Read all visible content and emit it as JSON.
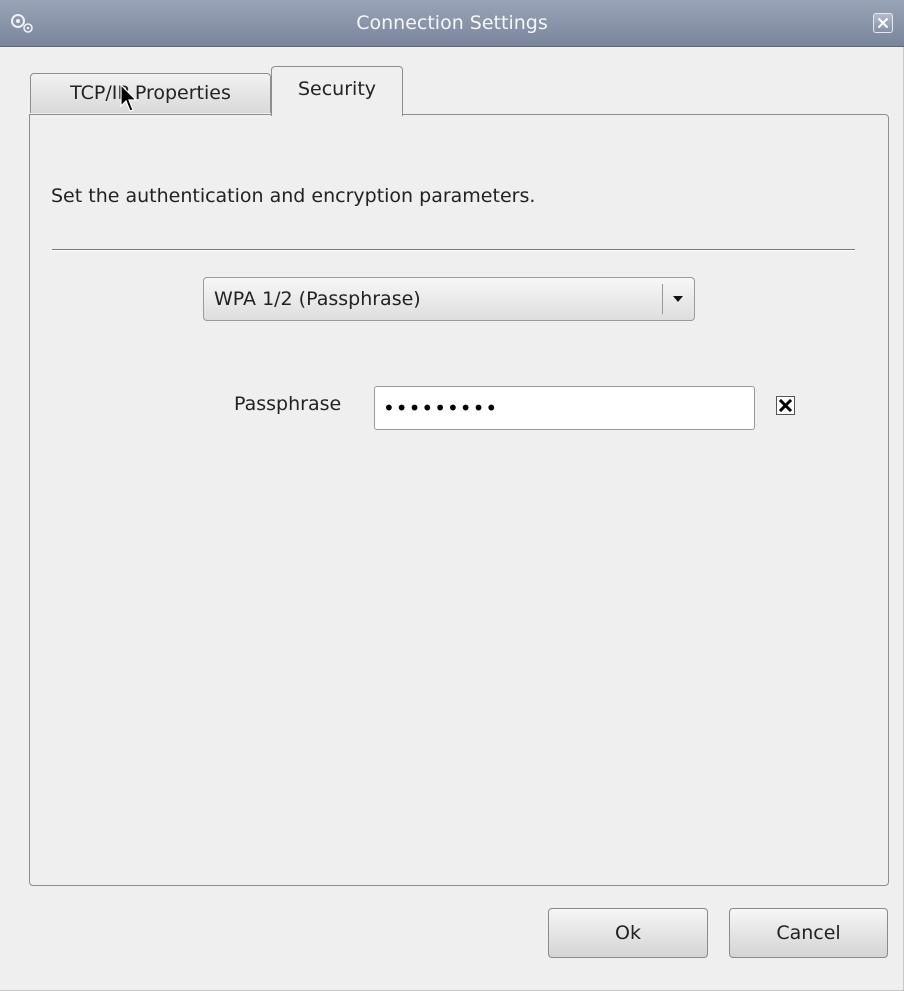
{
  "window": {
    "title": "Connection Settings",
    "icon": "gears-icon",
    "close_icon": "close-icon"
  },
  "tabs": [
    {
      "label": "TCP/IP Properties",
      "selected": false
    },
    {
      "label": "Security",
      "selected": true
    }
  ],
  "security": {
    "description": "Set the authentication and encryption parameters.",
    "method": {
      "selected": "WPA 1/2 (Passphrase)"
    },
    "passphrase": {
      "label": "Passphrase",
      "value": "•••••••••"
    },
    "show_passphrase_checked": true
  },
  "buttons": {
    "ok": "Ok",
    "cancel": "Cancel"
  },
  "colors": {
    "titlebar": "#8a94aa",
    "background": "#efefef"
  }
}
